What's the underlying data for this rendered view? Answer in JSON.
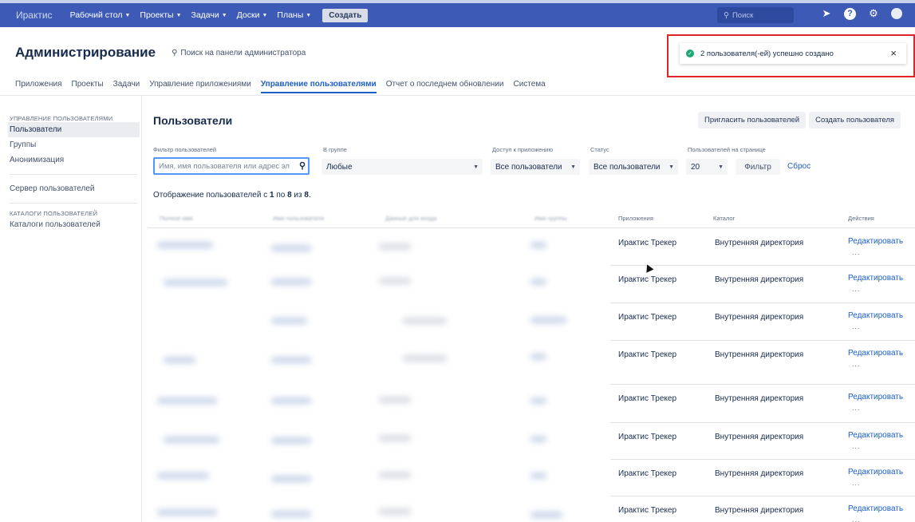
{
  "topbar": {
    "logo": "Ирактис",
    "nav": [
      {
        "label": "Рабочий стол"
      },
      {
        "label": "Проекты"
      },
      {
        "label": "Задачи"
      },
      {
        "label": "Доски"
      },
      {
        "label": "Планы"
      }
    ],
    "create_label": "Создать",
    "search_placeholder": "Поиск"
  },
  "header": {
    "title": "Администрирование",
    "admin_search": "Поиск на панели администратора"
  },
  "tabs": [
    {
      "label": "Приложения"
    },
    {
      "label": "Проекты"
    },
    {
      "label": "Задачи"
    },
    {
      "label": "Управление приложениями"
    },
    {
      "label": "Управление пользователями",
      "active": true
    },
    {
      "label": "Отчет о последнем обновлении"
    },
    {
      "label": "Система"
    }
  ],
  "notification": {
    "text": "2 пользователя(-ей) успешно создано",
    "close": "×"
  },
  "sidebar": {
    "section1": "УПРАВЛЕНИЕ ПОЛЬЗОВАТЕЛЯМИ",
    "items1": [
      "Пользователи",
      "Группы",
      "Анонимизация"
    ],
    "item_server": "Сервер пользователей",
    "section2": "КАТАЛОГИ ПОЛЬЗОВАТЕЛЕЙ",
    "items2": [
      "Каталоги пользователей"
    ]
  },
  "page": {
    "title": "Пользователи",
    "invite_button": "Пригласить пользователей",
    "create_button": "Создать пользователя"
  },
  "filters": {
    "user_filter_label": "Фильтр пользователей",
    "user_filter_placeholder": "Имя, имя пользователя или адрес эл",
    "group_label": "В группе",
    "group_value": "Любые",
    "access_label": "Доступ к приложению",
    "access_value": "Все пользователи",
    "status_label": "Статус",
    "status_value": "Все пользователи",
    "per_page_label": "Пользователей на странице",
    "per_page_value": "20",
    "filter_button": "Фильтр",
    "reset_link": "Сброс"
  },
  "showing": {
    "prefix": "Отображение пользователей с ",
    "from": "1",
    "mid": " по ",
    "to": "8",
    "of": " из ",
    "total": "8",
    "suffix": "."
  },
  "table": {
    "headers": [
      "Полное имя",
      "Имя пользователя",
      "Данные для входа",
      "Имя группы",
      "Приложения",
      "Каталог",
      "Действия"
    ],
    "rows": [
      {
        "app": "Ирактис Трекер",
        "dir": "Внутренняя директория",
        "edit": "Редактировать",
        "more": "..."
      },
      {
        "app": "Ирактис Трекер",
        "dir": "Внутренняя директория",
        "edit": "Редактировать",
        "more": "..."
      },
      {
        "app": "Ирактис Трекер",
        "dir": "Внутренняя директория",
        "edit": "Редактировать",
        "more": "..."
      },
      {
        "app": "Ирактис Трекер",
        "dir": "Внутренняя директория",
        "edit": "Редактировать",
        "more": "..."
      },
      {
        "app": "Ирактис Трекер",
        "dir": "Внутренняя директория",
        "edit": "Редактировать",
        "more": "..."
      },
      {
        "app": "Ирактис Трекер",
        "dir": "Внутренняя директория",
        "edit": "Редактировать",
        "more": "..."
      },
      {
        "app": "Ирактис Трекер",
        "dir": "Внутренняя директория",
        "edit": "Редактировать",
        "more": "..."
      },
      {
        "app": "Ирактис Трекер",
        "dir": "Внутренняя директория",
        "edit": "Редактировать",
        "more": "..."
      }
    ]
  }
}
